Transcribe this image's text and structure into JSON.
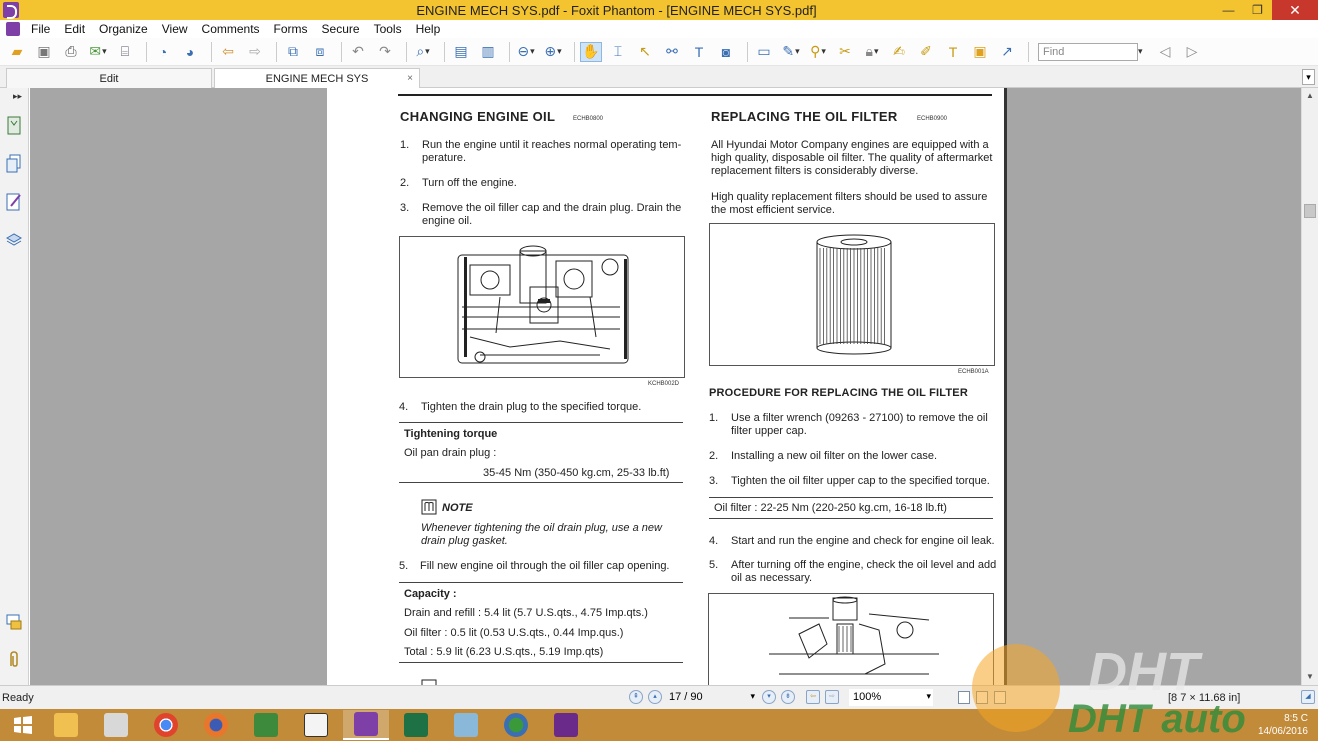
{
  "window": {
    "title": "ENGINE MECH SYS.pdf - Foxit Phantom - [ENGINE MECH SYS.pdf]",
    "minimize": "—",
    "restore": "❐",
    "close": "✕"
  },
  "menu": [
    "File",
    "Edit",
    "Organize",
    "View",
    "Comments",
    "Forms",
    "Secure",
    "Tools",
    "Help"
  ],
  "toolbar": {
    "find_placeholder": "Find"
  },
  "tabs": [
    {
      "label": "Edit",
      "active": false
    },
    {
      "label": "ENGINE MECH SYS",
      "active": true,
      "close": "×"
    }
  ],
  "document": {
    "left": {
      "heading": "CHANGING ENGINE OIL",
      "heading_code": "ECHB0800",
      "step1_num": "1.",
      "step1_a": "Run the engine until it reaches normal operating tem-",
      "step1_b": "perature.",
      "step2_num": "2.",
      "step2": "Turn off the engine.",
      "step3_num": "3.",
      "step3_a": "Remove the oil filler cap and the drain plug. Drain the",
      "step3_b": "engine oil.",
      "fig_code": "KCHB002D",
      "step4_num": "4.",
      "step4": "Tighten the drain plug to the specified torque.",
      "torque_title": "Tightening torque",
      "torque_label": "Oil pan drain plug :",
      "torque_value": "35-45 Nm (350-450 kg.cm, 25-33 lb.ft)",
      "note_label": "NOTE",
      "note_a": "Whenever tightening the oil drain plug, use a new",
      "note_b": "drain plug gasket.",
      "step5_num": "5.",
      "step5": "Fill new engine oil through the oil filler cap opening.",
      "capacity_title": "Capacity :",
      "cap1": "Drain and refill : 5.4 lit (5.7 U.S.qts., 4.75 Imp.qts.)",
      "cap2": "Oil filter : 0.5 lit (0.53 U.S.qts., 0.44 Imp.qus.)",
      "cap3": "Total : 5.9 lit (6.23 U.S.qts., 5.19 Imp.qts)"
    },
    "right": {
      "heading": "REPLACING THE OIL FILTER",
      "heading_code": "ECHB0900",
      "intro_a": "All Hyundai Motor Company engines are equipped with a",
      "intro_b": "high quality, disposable oil filter. The quality of aftermarket",
      "intro_c": "replacement filters is considerably diverse.",
      "intro2_a": "High quality replacement filters should be used to assure",
      "intro2_b": "the most efficient service.",
      "fig_code": "ECHB001A",
      "proc_heading": "PROCEDURE FOR REPLACING THE OIL FILTER",
      "p1_num": "1.",
      "p1_a": "Use a filter wrench (09263 - 27100) to remove the oil",
      "p1_b": "filter upper cap.",
      "p2_num": "2.",
      "p2": "Installing a new oil filter on the lower case.",
      "p3_num": "3.",
      "p3": "Tighten the oil filter upper cap to the specified torque.",
      "spec": "Oil filter : 22-25 Nm (220-250 kg.cm, 16-18 lb.ft)",
      "p4_num": "4.",
      "p4": "Start and run the engine and check for engine oil leak.",
      "p5_num": "5.",
      "p5_a": "After turning off the engine, check the oil level and add",
      "p5_b": "oil as necessary."
    }
  },
  "status": {
    "ready": "Ready",
    "page": "17 / 90",
    "zoom": "100%",
    "dims_a": "[8",
    "dims_b": "7 × 11.68 in]"
  },
  "taskbar": {
    "time": "8:5 C",
    "date": "14/06/2016"
  },
  "watermark": {
    "text": "DHT auto"
  },
  "colors": {
    "titlebar": "#f4c430",
    "taskbar": "#c28b3a",
    "docbg": "#a6a6a6",
    "close": "#c7372c"
  }
}
